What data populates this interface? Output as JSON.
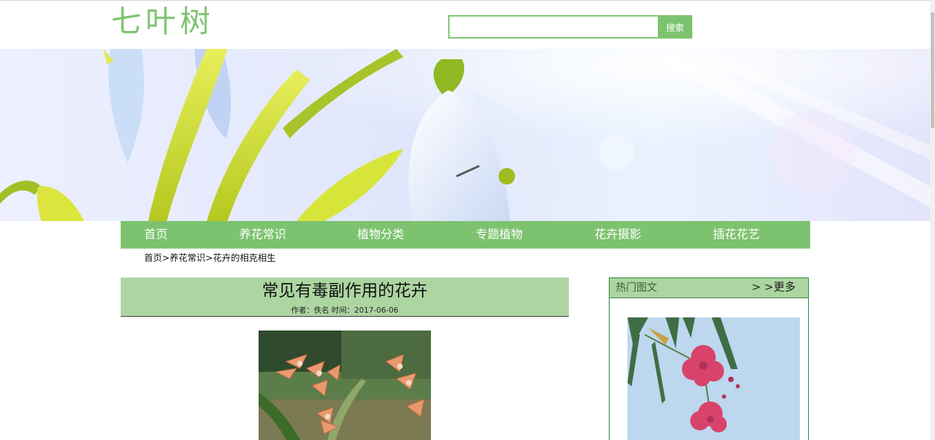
{
  "header": {
    "logo_text": "七叶树",
    "search": {
      "value": "",
      "placeholder": "",
      "button_label": "搜索"
    }
  },
  "nav": {
    "items": [
      {
        "label": "首页"
      },
      {
        "label": "养花常识"
      },
      {
        "label": "植物分类"
      },
      {
        "label": "专题植物"
      },
      {
        "label": "花卉摄影"
      },
      {
        "label": "插花花艺"
      }
    ]
  },
  "breadcrumb": "首页>养花常识>花卉的相克相生",
  "article": {
    "title": "常见有毒副作用的花卉",
    "meta": "作者：佚名 时间：2017-06-06"
  },
  "sidebar": {
    "title": "热门图文",
    "more_label": "> >更多"
  },
  "colors": {
    "accent": "#7dc36f",
    "accent_light": "#acd5a1",
    "border_dark": "#2e7d32"
  }
}
